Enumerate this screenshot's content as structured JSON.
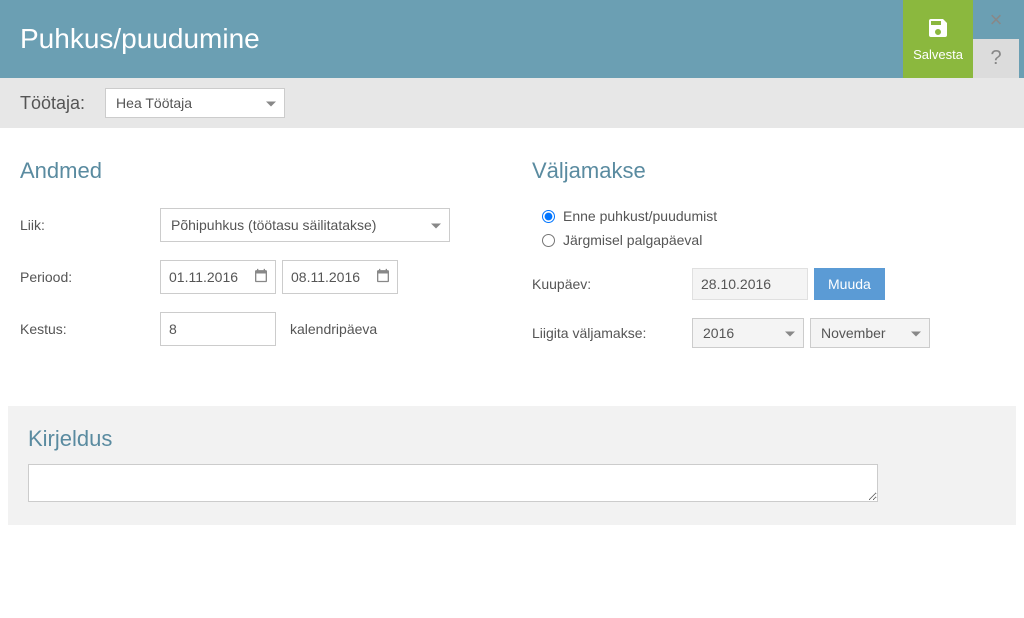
{
  "header": {
    "title": "Puhkus/puudumine",
    "save_label": "Salvesta",
    "close_label": "×",
    "help_label": "?"
  },
  "employee": {
    "label": "Töötaja:",
    "selected": "Hea Töötaja"
  },
  "andmed": {
    "title": "Andmed",
    "liik_label": "Liik:",
    "liik_value": "Põhipuhkus (töötasu säilitatakse)",
    "periood_label": "Periood:",
    "periood_start": "01.11.2016",
    "periood_end": "08.11.2016",
    "kestus_label": "Kestus:",
    "kestus_value": "8",
    "kestus_unit": "kalendripäeva"
  },
  "valjamakse": {
    "title": "Väljamakse",
    "opt_before": "Enne puhkust/puudumist",
    "opt_next": "Järgmisel palgapäeval",
    "kuupaev_label": "Kuupäev:",
    "kuupaev_value": "28.10.2016",
    "muuda_label": "Muuda",
    "liigita_label": "Liigita väljamakse:",
    "year_value": "2016",
    "month_value": "November"
  },
  "kirjeldus": {
    "title": "Kirjeldus",
    "value": ""
  }
}
